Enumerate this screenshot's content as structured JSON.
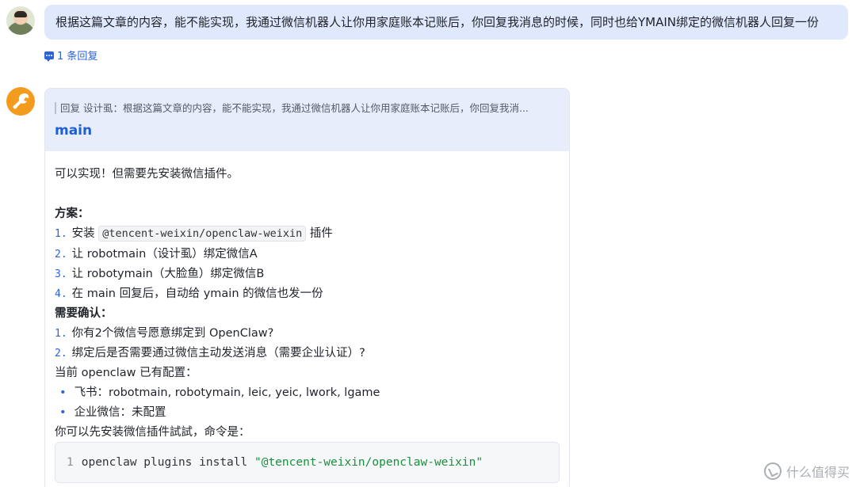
{
  "user_message": {
    "text": "根据这篇文章的内容，能不能实现，我通过微信机器人让你用家庭账本记账后，你回复我消息的时候，同时也给YMAIN绑定的微信机器人回复一份",
    "reply_count_label": "1 条回复"
  },
  "bot_message": {
    "quote_text": "回复 设计虱：根据这篇文章的内容，能不能实现，我通过微信机器人让你用家庭账本记账后，你回复我消...",
    "sender": "main",
    "intro": "可以实现！但需要先安装微信插件。",
    "plan_heading": "方案",
    "plan_items": [
      {
        "num": "1.",
        "prefix": "安装",
        "code": "@tencent-weixin/openclaw-weixin",
        "suffix": "插件"
      },
      {
        "num": "2.",
        "text": "让 robotmain（设计虱）绑定微信A"
      },
      {
        "num": "3.",
        "text": "让 robotymain（大脸鱼）绑定微信B"
      },
      {
        "num": "4.",
        "text": "在 main 回复后，自动给 ymain 的微信也发一份"
      }
    ],
    "confirm_heading": "需要确认",
    "confirm_items": [
      {
        "num": "1.",
        "text": "你有2个微信号愿意绑定到 OpenClaw?"
      },
      {
        "num": "2.",
        "text": "绑定后是否需要通过微信主动发送消息（需要企业认证）?"
      }
    ],
    "config_intro": "当前 openclaw 已有配置：",
    "config_items": [
      "飞书：robotmain, robotymain, leic, yeic, lwork, lgame",
      "企业微信：未配置"
    ],
    "try_text": "你可以先安装微信插件試試，命令是：",
    "code": {
      "line_number": "1",
      "command": "openclaw plugins install ",
      "string": "\"@tencent-weixin/openclaw-weixin\""
    }
  },
  "watermark": {
    "text": "什么值得买"
  },
  "colors": {
    "user_bubble": "#dfe8fc",
    "bot_header": "#e7edfb",
    "accent": "#2b63d9",
    "bot_avatar": "#f29b1d",
    "code_string": "#1a8f3c"
  },
  "icons": {
    "reply": "comment-icon",
    "bot_avatar": "lobster-claw-icon",
    "watermark": "smzdm-logo-icon"
  }
}
